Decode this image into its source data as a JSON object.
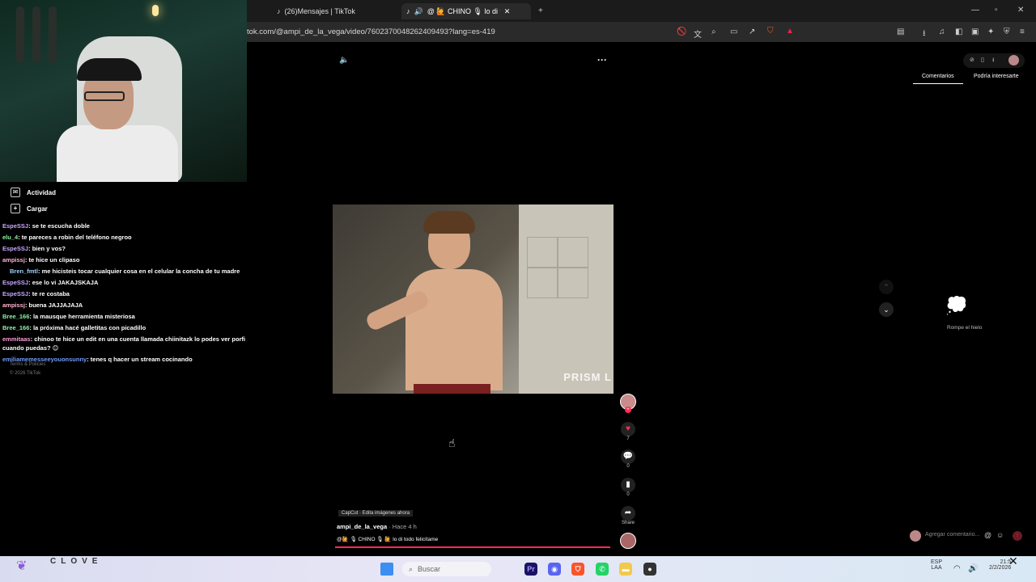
{
  "tabs": [
    {
      "label": "(26)Mensajes | TikTok"
    },
    {
      "label": "@ 🙋 CHINO 🎙 lo di to"
    }
  ],
  "address": {
    "url": "tok.com/@ampi_de_la_vega/video/7602370048262409493?lang=es-419"
  },
  "sidebar": {
    "items": [
      {
        "label": "Actividad",
        "icon": "activity-icon"
      },
      {
        "label": "Cargar",
        "icon": "upload-icon"
      }
    ],
    "footer": {
      "terms": "Terms & Policies",
      "copyright": "© 2026 TikTok"
    }
  },
  "chat": [
    {
      "user": "EspeSSJ",
      "color": "#c9a7ff",
      "text": ": se te escucha doble"
    },
    {
      "user": "elu_4",
      "color": "#8ff0a4",
      "text": ": te pareces a robin del teléfono negroo"
    },
    {
      "user": "EspeSSJ",
      "color": "#c9a7ff",
      "text": ": bien y vos?"
    },
    {
      "user": "ampissj",
      "color": "#ffb3d1",
      "text": ": te hice un clipaso"
    },
    {
      "user": "Bren_fmtl",
      "color": "#9fd3ff",
      "text": ": me hicisteis tocar cualquier cosa en el celular la concha de tu madre"
    },
    {
      "user": "EspeSSJ",
      "color": "#c9a7ff",
      "text": ": ese lo vi JAKAJSKAJA"
    },
    {
      "user": "EspeSSJ",
      "color": "#c9a7ff",
      "text": ": te re costaba"
    },
    {
      "user": "ampissj",
      "color": "#ffb3d1",
      "text": ": buena JAJJAJAJA"
    },
    {
      "user": "Bree_166",
      "color": "#8ff0a4",
      "text": ": la mausque herramienta misteriosa"
    },
    {
      "user": "Bree_166",
      "color": "#8ff0a4",
      "text": ": la próxima hacé galletitas con picadillo"
    },
    {
      "user": "emmitaas",
      "color": "#ff9ad5",
      "text": ": chinoo te hice un edit en una cuenta llamada chiinitazk lo podes ver porfi"
    },
    {
      "user": "",
      "color": "#ffffff",
      "text": "cuando puedas? 😊"
    },
    {
      "user": "emiliamemesseeyouonsunny",
      "color": "#6f9dff",
      "text": ": tenes q hacer un stream cocinando"
    }
  ],
  "video": {
    "watermark": "PRISM L",
    "capcut": "CapCut · Edita imágenes ahora",
    "author": "ampi_de_la_vega",
    "time": " · Hace 4 h",
    "caption": "@🙋 🎙 CHINO 🎙 🙋 lo di todo felicítame"
  },
  "actions": {
    "likes": "7",
    "comments": "0",
    "saves": "0",
    "share": "Share"
  },
  "comments_panel": {
    "tab_comments": "Comentarios",
    "tab_interest": "Podría interesarte",
    "empty": "Rompe el hielo",
    "input_placeholder": "Agregar comentario..."
  },
  "taskbar": {
    "brand": "CLOVE",
    "search_placeholder": "Buscar",
    "lang": "ESP",
    "region": "LAA",
    "time": "21:5",
    "date": "2/2/2026"
  }
}
